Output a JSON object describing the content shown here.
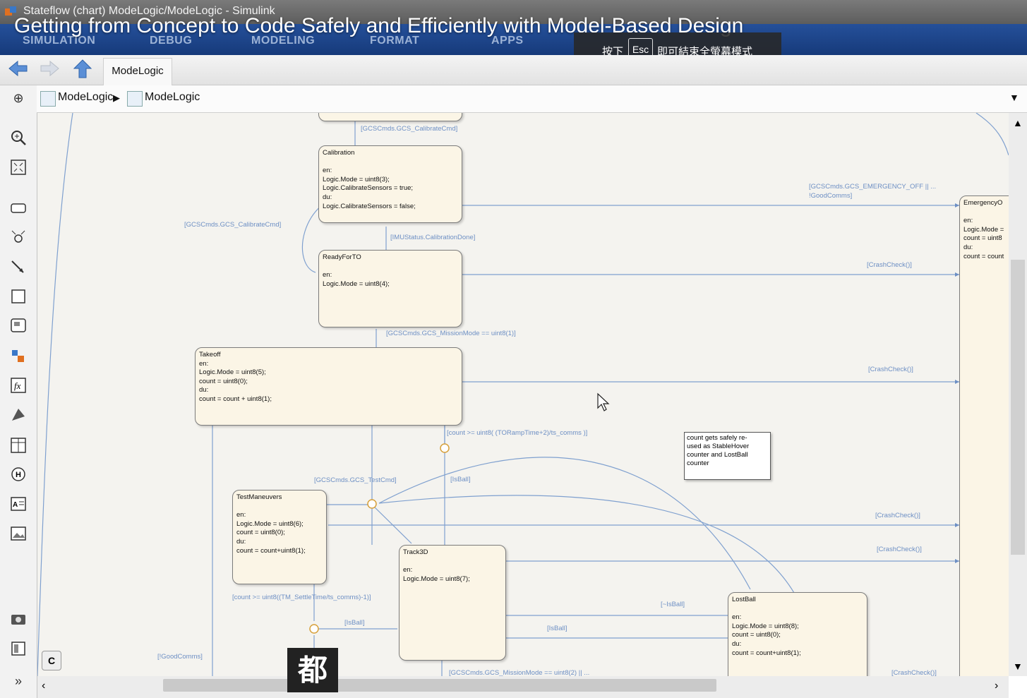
{
  "window": {
    "title": "Stateflow (chart) ModeLogic/ModeLogic - Simulink"
  },
  "video_title": "Getting from Concept to Code Safely and Efficiently with Model-Based Design",
  "ribbon": {
    "tabs": [
      "SIMULATION",
      "DEBUG",
      "MODELING",
      "FORMAT",
      "APPS"
    ]
  },
  "fullscreen_hint": {
    "before": "按下",
    "key": "Esc",
    "after": "即可結束全螢幕模式"
  },
  "toolbar": {
    "tab_label": "ModeLogic"
  },
  "breadcrumb": [
    "ModeLogic",
    "ModeLogic"
  ],
  "palette": {
    "icons": [
      "hide-pane-icon",
      "zoom-icon",
      "fit-view-icon",
      "state-tool-icon",
      "default-transition-icon",
      "transition-tool-icon",
      "box-icon",
      "subchart-icon",
      "simulink-function-icon",
      "matlab-function-icon",
      "simulink-state-icon",
      "truth-table-icon",
      "history-junction-icon",
      "annotation-icon",
      "image-icon",
      "screenshot-icon",
      "explorer-icon",
      "expand-icon"
    ]
  },
  "states": {
    "calibration": "Calibration\n\nen:\nLogic.Mode = uint8(3);\nLogic.CalibrateSensors = true;\ndu:\nLogic.CalibrateSensors = false;",
    "readyforto": "ReadyForTO\n\nen:\nLogic.Mode = uint8(4);",
    "takeoff": "Takeoff\nen:\nLogic.Mode = uint8(5);\ncount = uint8(0);\ndu:\ncount = count + uint8(1);",
    "testmaneuvers": "TestManeuvers\n\nen:\nLogic.Mode = uint8(6);\ncount = uint8(0);\ndu:\ncount = count+uint8(1);",
    "track3d": "Track3D\n\nen:\nLogic.Mode = uint8(7);",
    "lostball": "LostBall\n\nen:\nLogic.Mode = uint8(8);\ncount = uint8(0);\ndu:\ncount = count+uint8(1);",
    "emergency": "EmergencyO\n\nen:\nLogic.Mode =\ncount = uint8\ndu:\ncount = count"
  },
  "note": "count gets safely re-\nused as StableHover\ncounter and LostBall\ncounter",
  "transitions": {
    "t1": "[GCSCmds.GCS_CalibrateCmd]",
    "t2": "[GCSCmds.GCS_CalibrateCmd]",
    "t3": "[IMUStatus.CalibrationDone]",
    "t4": "[GCSCmds.GCS_EMERGENCY_OFF || ...",
    "t4b": "!GoodComms]",
    "t5": "[CrashCheck()]",
    "t6": "[GCSCmds.GCS_MissionMode == uint8(1)]",
    "t7": "[CrashCheck()]",
    "t8": "[count >= uint8( (TORampTime+2)/ts_comms )]",
    "t9": "[GCSCmds.GCS_TestCmd]",
    "t10": "[IsBall]",
    "t11": "[CrashCheck()]",
    "t12": "[CrashCheck()]",
    "t13": "[count >= uint8((TM_SettleTime/ts_comms)-1)]",
    "t14": "[~IsBall]",
    "t15": "[IsBall]",
    "t16": "[IsBall]",
    "t17": "[!GoodComms]",
    "t18": "[GCSCmds.GCS_MissionMode == uint8(2) || ...",
    "t19": "[CrashCheck()]"
  },
  "overlay_char": "都",
  "colors": {
    "ribbon": "#1b4488",
    "canvas": "#f4f3ef",
    "state_fill": "#fbf5e6",
    "transition": "#6d8fc4"
  }
}
